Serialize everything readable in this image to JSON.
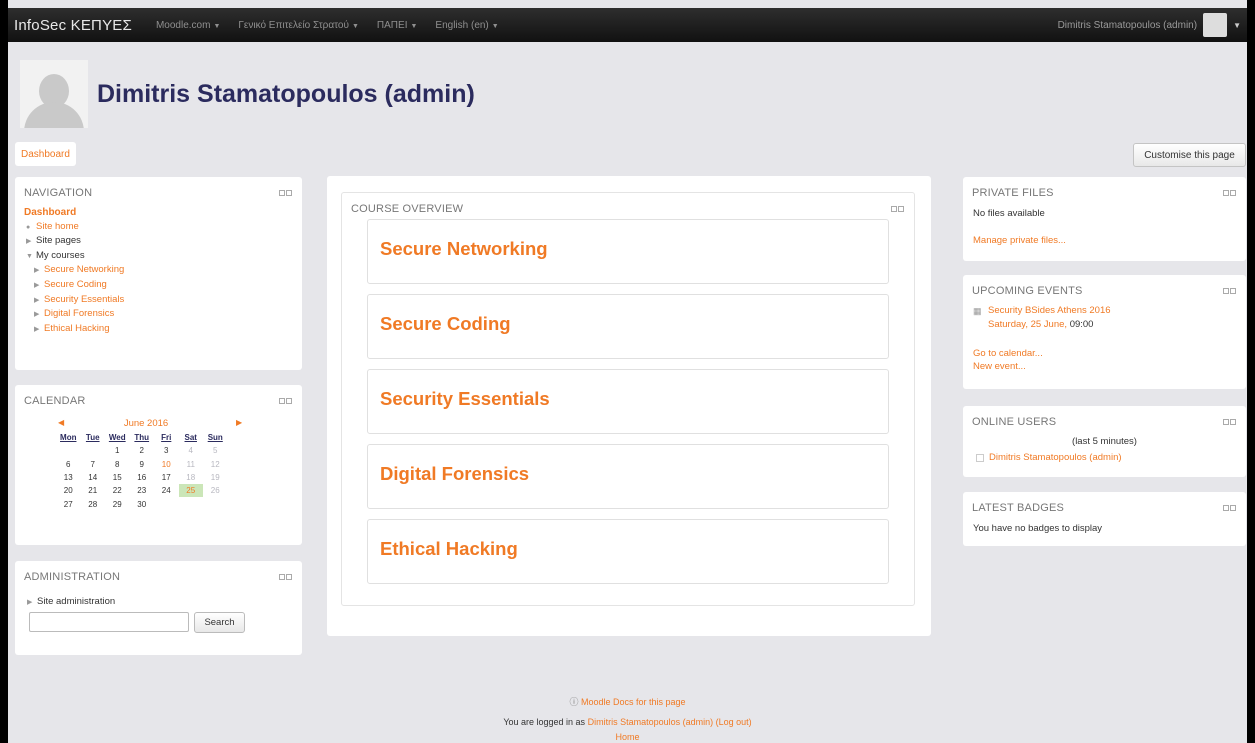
{
  "navbar": {
    "brand": "InfoSec ΚΕΠΥΕΣ",
    "menu": [
      {
        "label": "Moodle.com"
      },
      {
        "label": "Γενικό Επιτελείο Στρατού"
      },
      {
        "label": "ΠΑΠΕΙ"
      },
      {
        "label": "English (en)"
      }
    ],
    "user_name": "Dimitris Stamatopoulos (admin)"
  },
  "header": {
    "title": "Dimitris Stamatopoulos (admin)",
    "breadcrumb": "Dashboard",
    "customise_button": "Customise this page"
  },
  "navigation_block": {
    "title": "NAVIGATION",
    "dashboard": "Dashboard",
    "site_home": "Site home",
    "site_pages": "Site pages",
    "my_courses": "My courses",
    "courses": [
      "Secure Networking",
      "Secure Coding",
      "Security Essentials",
      "Digital Forensics",
      "Ethical Hacking"
    ]
  },
  "calendar_block": {
    "title": "CALENDAR",
    "month": "June 2016",
    "days": [
      "Mon",
      "Tue",
      "Wed",
      "Thu",
      "Fri",
      "Sat",
      "Sun"
    ],
    "weeks": [
      [
        "",
        "",
        "1",
        "2",
        "3",
        "4",
        "5"
      ],
      [
        "6",
        "7",
        "8",
        "9",
        "10",
        "11",
        "12"
      ],
      [
        "13",
        "14",
        "15",
        "16",
        "17",
        "18",
        "19"
      ],
      [
        "20",
        "21",
        "22",
        "23",
        "24",
        "25",
        "26"
      ],
      [
        "27",
        "28",
        "29",
        "30",
        "",
        "",
        ""
      ]
    ],
    "event_day": "10",
    "today": "25"
  },
  "administration_block": {
    "title": "ADMINISTRATION",
    "site_admin": "Site administration",
    "search_button": "Search"
  },
  "course_overview": {
    "title": "COURSE OVERVIEW",
    "courses": [
      "Secure Networking",
      "Secure Coding",
      "Security Essentials",
      "Digital Forensics",
      "Ethical Hacking"
    ]
  },
  "private_files": {
    "title": "PRIVATE FILES",
    "empty": "No files available",
    "manage": "Manage private files..."
  },
  "upcoming_events": {
    "title": "UPCOMING EVENTS",
    "event_name": "Security BSides Athens 2016",
    "event_date": "Saturday, 25 June,",
    "event_time": "09:00",
    "goto_calendar": "Go to calendar...",
    "new_event": "New event..."
  },
  "online_users": {
    "title": "ONLINE USERS",
    "period": "(last 5 minutes)",
    "user": "Dimitris Stamatopoulos (admin)"
  },
  "latest_badges": {
    "title": "LATEST BADGES",
    "empty": "You have no badges to display"
  },
  "footer": {
    "docs_link": "Moodle Docs for this page",
    "logged_in_prefix": "You are logged in as",
    "user": "Dimitris Stamatopoulos (admin)",
    "logout": "(Log out)",
    "home": "Home"
  },
  "colors": {
    "accent": "#f07a25",
    "title": "#2b2b5e",
    "page_bg": "#e6e6ea",
    "today_bg": "#cbe6b8"
  }
}
